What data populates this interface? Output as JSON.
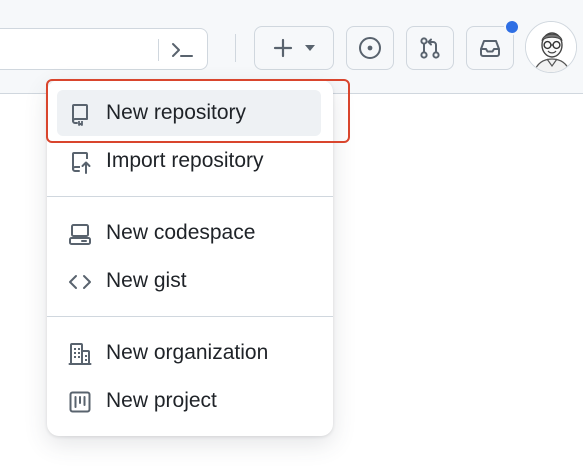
{
  "header": {
    "icons": {
      "command": "terminal-icon",
      "create": "plus-icon",
      "create_caret": "triangle-down-icon",
      "issues": "issue-opened-icon",
      "pulls": "git-pull-request-icon",
      "inbox": "inbox-icon",
      "avatar": "user-avatar"
    },
    "notification_color": "#2f6fe4"
  },
  "menu": {
    "groups": [
      [
        {
          "label": "New repository",
          "icon": "repo-icon",
          "active": true
        },
        {
          "label": "Import repository",
          "icon": "repo-push-icon"
        }
      ],
      [
        {
          "label": "New codespace",
          "icon": "codespaces-icon"
        },
        {
          "label": "New gist",
          "icon": "code-icon"
        }
      ],
      [
        {
          "label": "New organization",
          "icon": "organization-icon"
        },
        {
          "label": "New project",
          "icon": "project-icon"
        }
      ]
    ]
  },
  "highlight_color": "#d9452d"
}
